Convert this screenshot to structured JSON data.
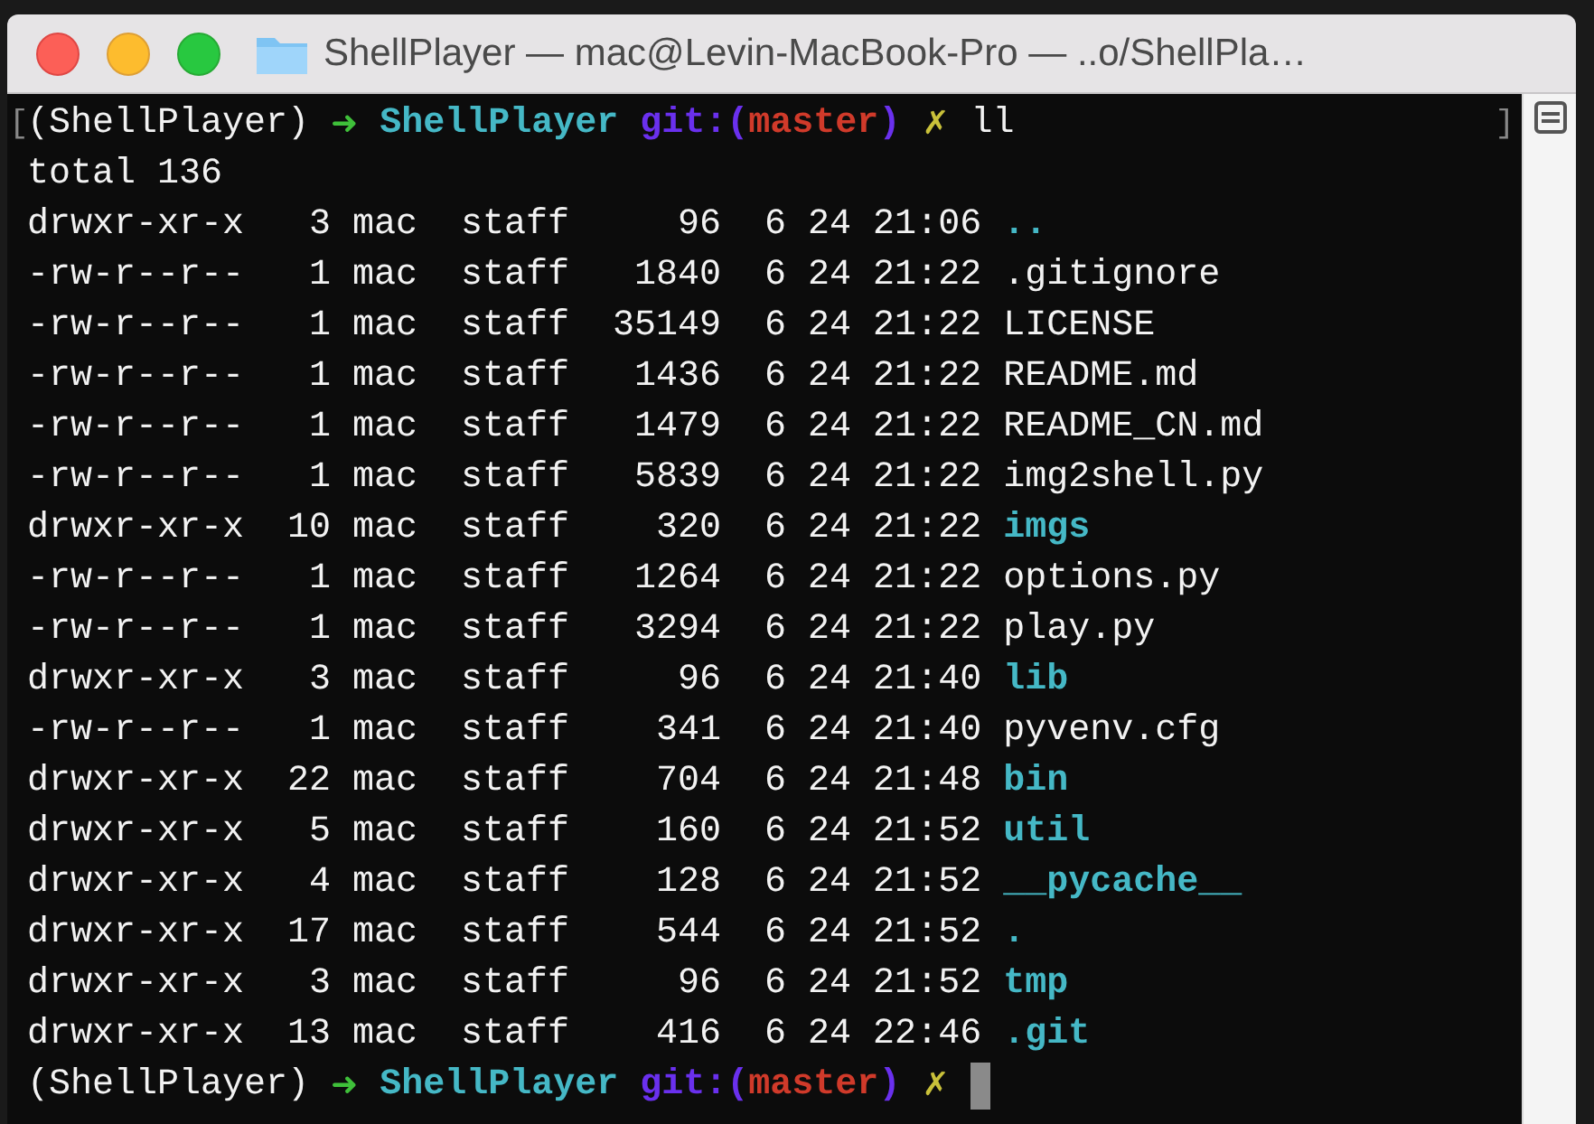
{
  "window": {
    "title": "ShellPlayer — mac@Levin-MacBook-Pro — ..o/ShellPla…"
  },
  "terminal": {
    "lines": [
      {
        "kind": "prompt",
        "mark_open": "[",
        "mark_close": "]",
        "env": "(ShellPlayer)",
        "arrow": "➜",
        "directory": "ShellPlayer",
        "git_prefix": "git:(",
        "branch": "master",
        "git_suffix": ")",
        "dirty_mark": "✗",
        "command": "ll"
      },
      {
        "kind": "text",
        "text": "total 136"
      },
      {
        "kind": "entry",
        "permissions": "drwxr-xr-x",
        "links": "3",
        "owner": "mac",
        "group": "staff",
        "size": "96",
        "modified": "6 24 21:06",
        "name": "..",
        "directory": true
      },
      {
        "kind": "entry",
        "permissions": "-rw-r--r--",
        "links": "1",
        "owner": "mac",
        "group": "staff",
        "size": "1840",
        "modified": "6 24 21:22",
        "name": ".gitignore",
        "directory": false
      },
      {
        "kind": "entry",
        "permissions": "-rw-r--r--",
        "links": "1",
        "owner": "mac",
        "group": "staff",
        "size": "35149",
        "modified": "6 24 21:22",
        "name": "LICENSE",
        "directory": false
      },
      {
        "kind": "entry",
        "permissions": "-rw-r--r--",
        "links": "1",
        "owner": "mac",
        "group": "staff",
        "size": "1436",
        "modified": "6 24 21:22",
        "name": "README.md",
        "directory": false
      },
      {
        "kind": "entry",
        "permissions": "-rw-r--r--",
        "links": "1",
        "owner": "mac",
        "group": "staff",
        "size": "1479",
        "modified": "6 24 21:22",
        "name": "README_CN.md",
        "directory": false
      },
      {
        "kind": "entry",
        "permissions": "-rw-r--r--",
        "links": "1",
        "owner": "mac",
        "group": "staff",
        "size": "5839",
        "modified": "6 24 21:22",
        "name": "img2shell.py",
        "directory": false
      },
      {
        "kind": "entry",
        "permissions": "drwxr-xr-x",
        "links": "10",
        "owner": "mac",
        "group": "staff",
        "size": "320",
        "modified": "6 24 21:22",
        "name": "imgs",
        "directory": true
      },
      {
        "kind": "entry",
        "permissions": "-rw-r--r--",
        "links": "1",
        "owner": "mac",
        "group": "staff",
        "size": "1264",
        "modified": "6 24 21:22",
        "name": "options.py",
        "directory": false
      },
      {
        "kind": "entry",
        "permissions": "-rw-r--r--",
        "links": "1",
        "owner": "mac",
        "group": "staff",
        "size": "3294",
        "modified": "6 24 21:22",
        "name": "play.py",
        "directory": false
      },
      {
        "kind": "entry",
        "permissions": "drwxr-xr-x",
        "links": "3",
        "owner": "mac",
        "group": "staff",
        "size": "96",
        "modified": "6 24 21:40",
        "name": "lib",
        "directory": true
      },
      {
        "kind": "entry",
        "permissions": "-rw-r--r--",
        "links": "1",
        "owner": "mac",
        "group": "staff",
        "size": "341",
        "modified": "6 24 21:40",
        "name": "pyvenv.cfg",
        "directory": false
      },
      {
        "kind": "entry",
        "permissions": "drwxr-xr-x",
        "links": "22",
        "owner": "mac",
        "group": "staff",
        "size": "704",
        "modified": "6 24 21:48",
        "name": "bin",
        "directory": true
      },
      {
        "kind": "entry",
        "permissions": "drwxr-xr-x",
        "links": "5",
        "owner": "mac",
        "group": "staff",
        "size": "160",
        "modified": "6 24 21:52",
        "name": "util",
        "directory": true
      },
      {
        "kind": "entry",
        "permissions": "drwxr-xr-x",
        "links": "4",
        "owner": "mac",
        "group": "staff",
        "size": "128",
        "modified": "6 24 21:52",
        "name": "__pycache__",
        "directory": true
      },
      {
        "kind": "entry",
        "permissions": "drwxr-xr-x",
        "links": "17",
        "owner": "mac",
        "group": "staff",
        "size": "544",
        "modified": "6 24 21:52",
        "name": ".",
        "directory": true
      },
      {
        "kind": "entry",
        "permissions": "drwxr-xr-x",
        "links": "3",
        "owner": "mac",
        "group": "staff",
        "size": "96",
        "modified": "6 24 21:52",
        "name": "tmp",
        "directory": true
      },
      {
        "kind": "entry",
        "permissions": "drwxr-xr-x",
        "links": "13",
        "owner": "mac",
        "group": "staff",
        "size": "416",
        "modified": "6 24 22:46",
        "name": ".git",
        "directory": true
      },
      {
        "kind": "prompt",
        "env": "(ShellPlayer)",
        "arrow": "➜",
        "directory": "ShellPlayer",
        "git_prefix": "git:(",
        "branch": "master",
        "git_suffix": ")",
        "dirty_mark": "✗",
        "cursor": true
      }
    ]
  }
}
